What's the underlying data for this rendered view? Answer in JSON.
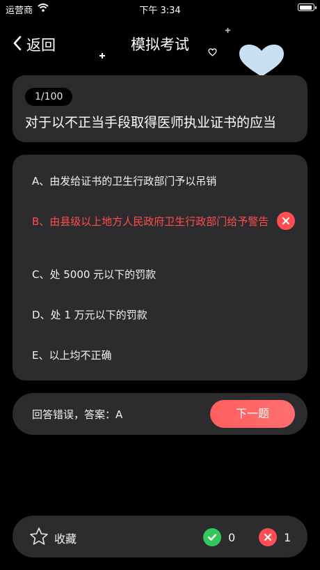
{
  "status_bar": {
    "carrier": "运营商",
    "time": "下午 3:34"
  },
  "nav": {
    "back_label": "返回",
    "title": "模拟考试"
  },
  "question": {
    "progress": "1/100",
    "text": "对于以不正当手段取得医师执业证书的应当"
  },
  "options": [
    {
      "text": "A、由发给证书的卫生行政部门予以吊销",
      "state": "normal"
    },
    {
      "text": "B、由县级以上地方人民政府卫生行政部门给予警告",
      "state": "wrong"
    },
    {
      "text": "C、处 5000 元以下的罚款",
      "state": "normal"
    },
    {
      "text": "D、处 1 万元以下的罚款",
      "state": "normal"
    },
    {
      "text": "E、以上均不正确",
      "state": "normal"
    }
  ],
  "answer_bar": {
    "result_text": "回答错误，答案：A",
    "next_label": "下一题"
  },
  "bottom_bar": {
    "favorite_label": "收藏",
    "correct_count": "0",
    "wrong_count": "1"
  },
  "colors": {
    "background": "#000000",
    "card": "#2c2c2e",
    "wrong": "#ff4d4f",
    "correct": "#34c759",
    "accent_button": "#ff6363",
    "heart": "#c9dff2"
  },
  "icons": [
    "wifi-icon",
    "battery-icon",
    "back-chevron-icon",
    "heart-icon",
    "plus-icon",
    "wrong-icon",
    "star-icon",
    "check-icon",
    "cross-icon"
  ]
}
